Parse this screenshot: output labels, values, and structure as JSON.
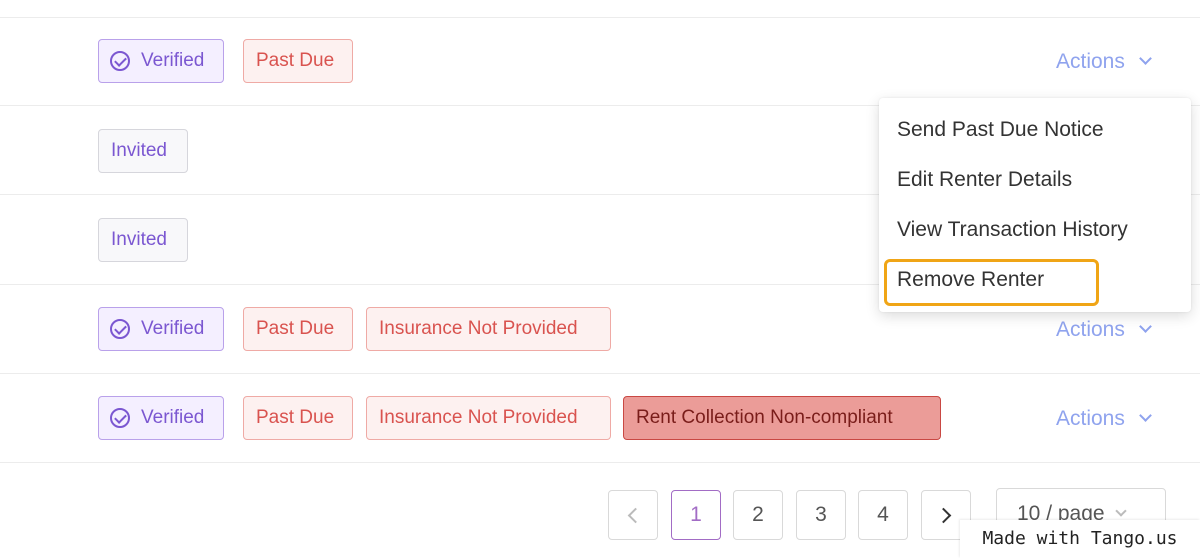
{
  "rows": [
    {
      "tags": [
        "Verified",
        "Past Due"
      ],
      "actions": "Actions"
    },
    {
      "tags": [
        "Invited"
      ]
    },
    {
      "tags": [
        "Invited"
      ]
    },
    {
      "tags": [
        "Verified",
        "Past Due",
        "Insurance Not Provided"
      ],
      "actions": "Actions"
    },
    {
      "tags": [
        "Verified",
        "Past Due",
        "Insurance Not Provided",
        "Rent Collection Non-compliant"
      ],
      "actions": "Actions"
    }
  ],
  "menu": {
    "items": [
      "Send Past Due Notice",
      "Edit Renter Details",
      "View Transaction History",
      "Remove Renter"
    ],
    "highlighted_index": 3
  },
  "pagination": {
    "pages": [
      "1",
      "2",
      "3",
      "4"
    ],
    "current": "1",
    "page_size": "10 / page"
  },
  "watermark": "Made with Tango.us",
  "colors": {
    "accent_purple": "#7b57d1",
    "danger": "#d9534f",
    "actions_link": "#8fa3ee",
    "highlight": "#f0a516"
  }
}
